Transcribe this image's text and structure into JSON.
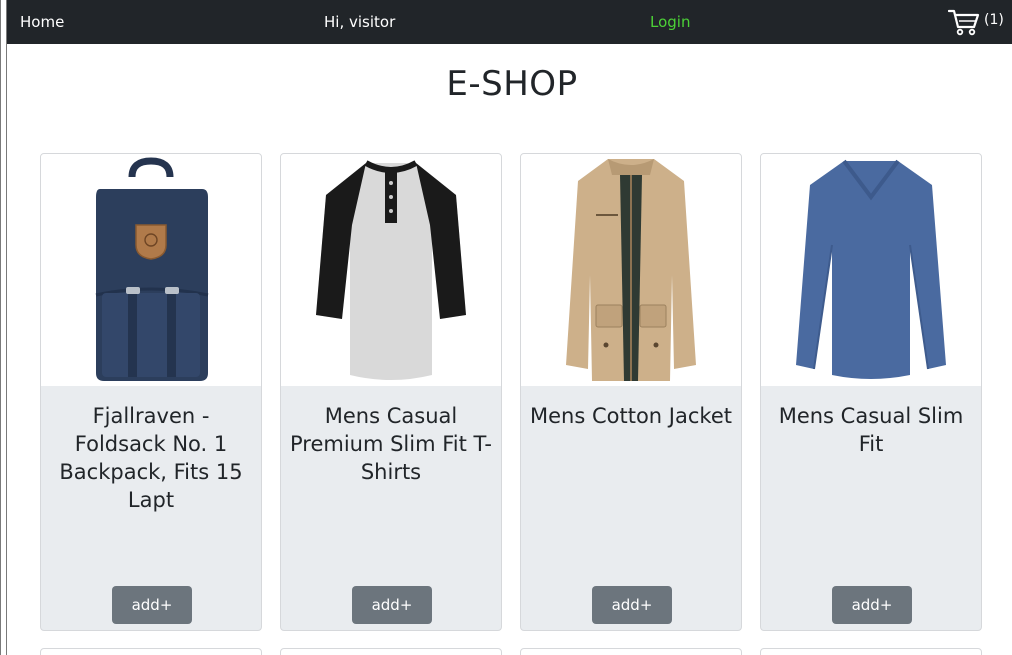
{
  "navbar": {
    "home_label": "Home",
    "greeting": "Hi, visitor",
    "login_label": "Login",
    "cart_count": "(1)"
  },
  "page": {
    "title": "E-SHOP"
  },
  "products": [
    {
      "title": "Fjallraven - Foldsack No. 1 Backpack, Fits 15 Lapt",
      "button": "add+",
      "image_icon": "backpack-icon"
    },
    {
      "title": "Mens Casual Premium Slim Fit T-Shirts",
      "button": "add+",
      "image_icon": "raglan-tshirt-icon"
    },
    {
      "title": "Mens Cotton Jacket",
      "button": "add+",
      "image_icon": "cotton-jacket-icon"
    },
    {
      "title": "Mens Casual Slim Fit",
      "button": "add+",
      "image_icon": "longsleeve-shirt-icon"
    }
  ],
  "colors": {
    "navbar_bg": "#212529",
    "login_green": "#4cd137",
    "card_body_bg": "#e9ecef",
    "button_bg": "#6c757d",
    "backpack_navy": "#2c3e5c",
    "tee_gray": "#d9d9d9",
    "jacket_tan": "#cdb08a",
    "shirt_blue": "#4a6aa0"
  }
}
